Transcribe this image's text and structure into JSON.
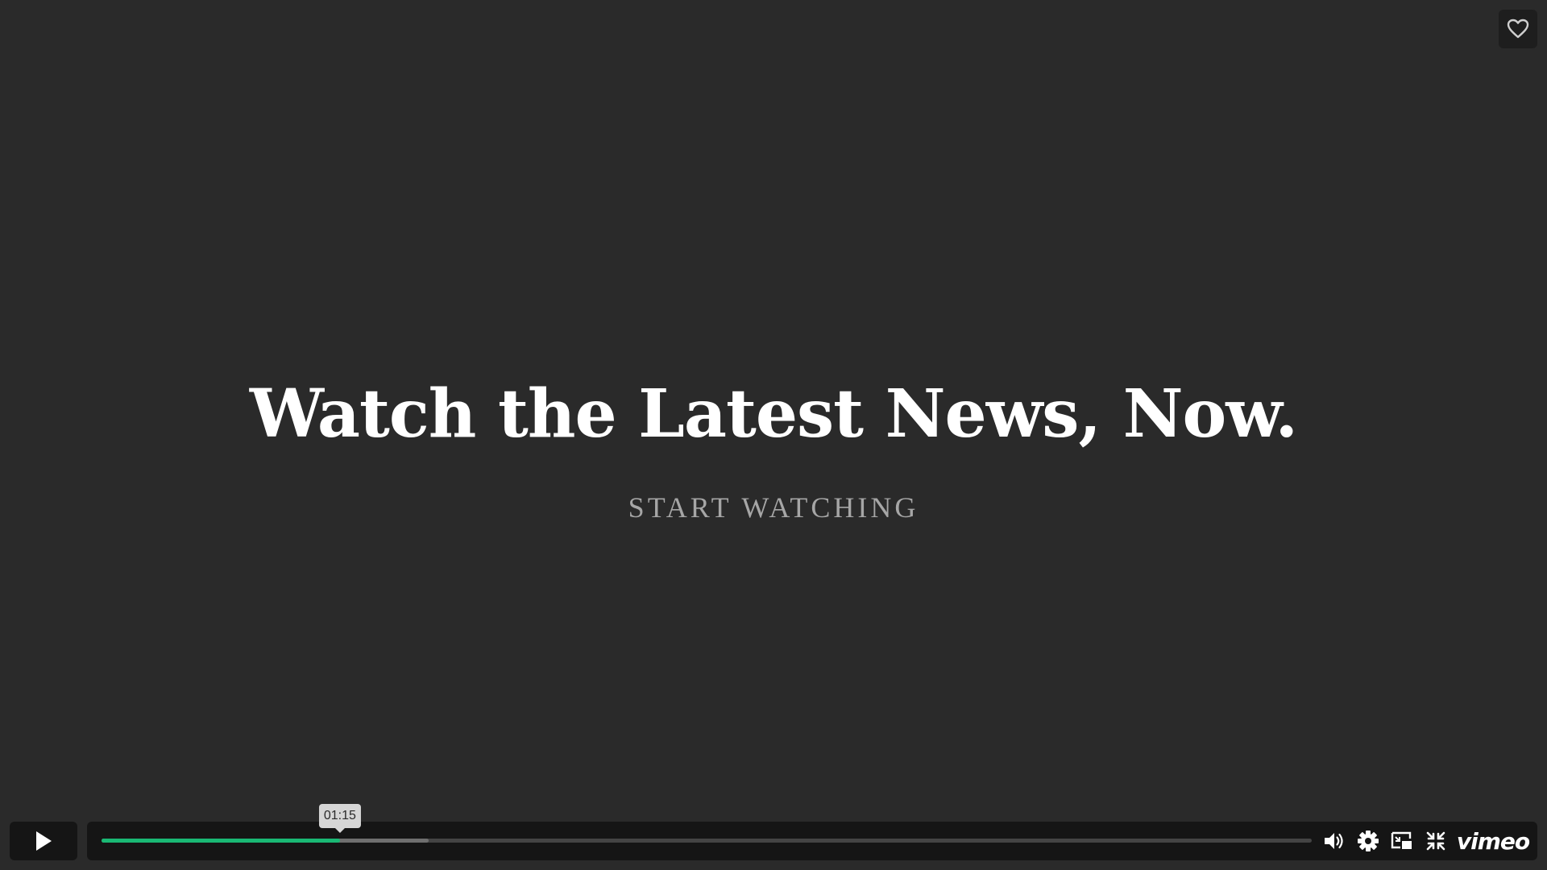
{
  "hero": {
    "headline": "Watch the Latest News, Now.",
    "cta_label": "START WATCHING"
  },
  "player": {
    "tooltip_time": "01:15",
    "played_fraction": 0.197,
    "buffered_fraction": 0.27,
    "logo_text": "vimeo",
    "accent_color": "#1ab874"
  },
  "icons": {
    "like": "heart-outline-icon",
    "play": "play-icon",
    "volume": "volume-icon",
    "settings": "gear-icon",
    "pip": "picture-in-picture-icon",
    "fullscreen": "exit-fullscreen-icon"
  }
}
